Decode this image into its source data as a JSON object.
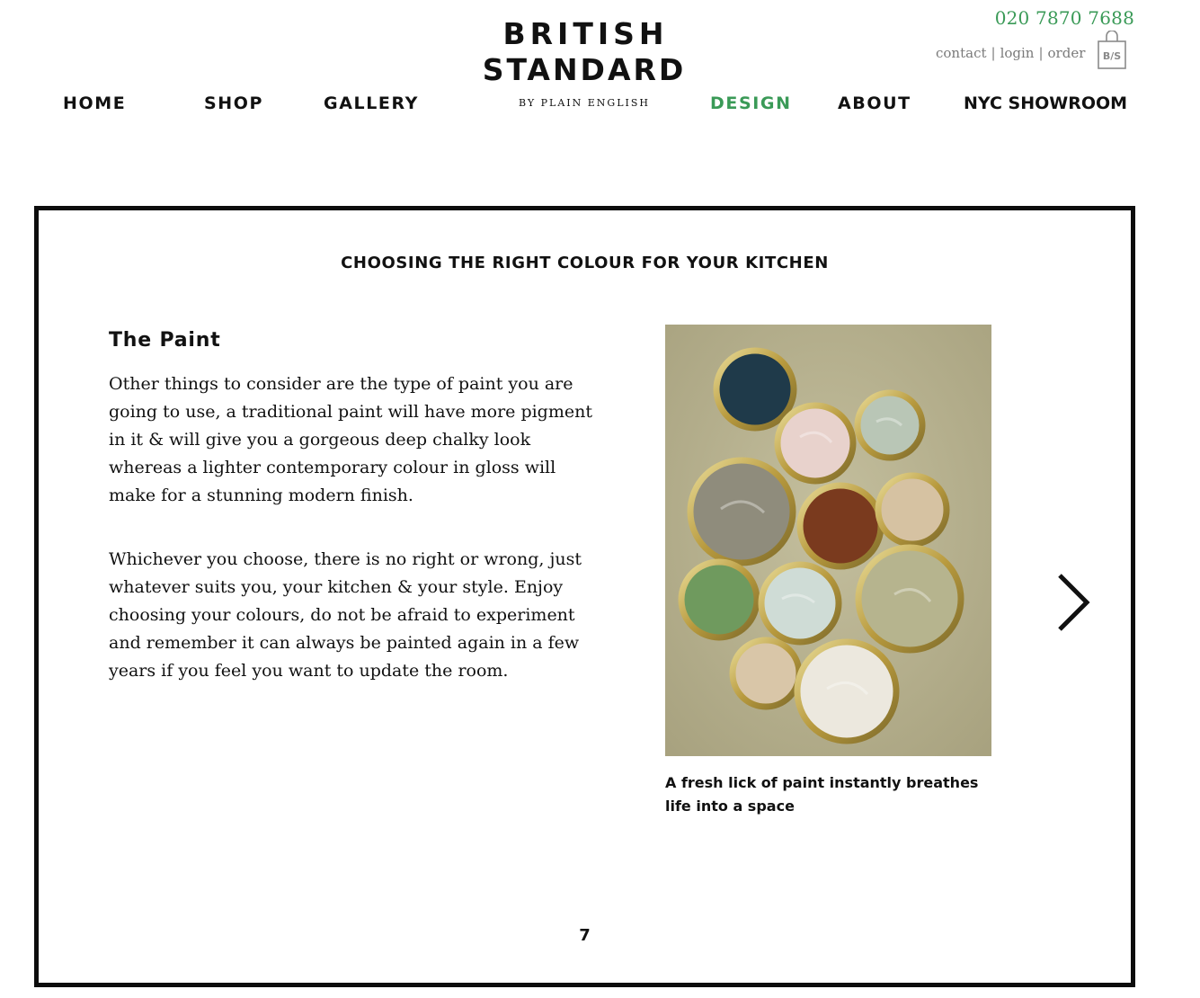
{
  "header": {
    "phone": "020 7870 7688",
    "links": [
      {
        "label": "contact"
      },
      {
        "label": "login"
      },
      {
        "label": "order"
      }
    ],
    "separator": "|",
    "logo": {
      "line1": "BRITISH",
      "line2": "STANDARD",
      "line3": "BY PLAIN ENGLISH"
    },
    "bag_icon": "shopping-bag-icon"
  },
  "nav": [
    {
      "label": "HOME",
      "active": false
    },
    {
      "label": "SHOP",
      "active": false
    },
    {
      "label": "GALLERY",
      "active": false
    },
    {
      "label": "DESIGN",
      "active": true
    },
    {
      "label": "ABOUT",
      "active": false
    },
    {
      "label": "NYC SHOWROOM",
      "active": false
    }
  ],
  "main": {
    "section_title": "CHOOSING THE RIGHT COLOUR FOR YOUR KITCHEN",
    "subtitle": "The Paint",
    "paragraphs": [
      "Other things to consider are the type of paint you are going to use, a traditional paint will have more pigment in it & will give you a gorgeous deep chalky look whereas a lighter contemporary colour in gloss will make for a stunning modern finish.",
      "Whichever you choose, there is no right or wrong, just whatever suits you, your kitchen & your style. Enjoy choosing your colours, do not be afraid to experiment and remember it can always be painted again in a few years if you feel you want to update the room."
    ],
    "image_caption": "A fresh lick of paint instantly breathes life into a space",
    "page_number": "7",
    "next_icon": "chevron-right-icon"
  },
  "colors": {
    "accent": "#3a9a57",
    "text": "#111111",
    "muted": "#7a7a7a",
    "frame": "#0d0d0d"
  }
}
